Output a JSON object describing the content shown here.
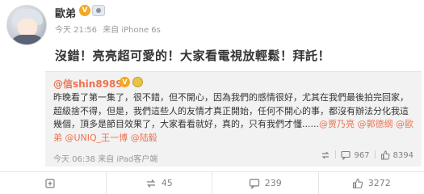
{
  "post": {
    "username": "歐弟",
    "vip_badge": "V",
    "time": "今天 21:56",
    "source": "来自 iPhone 6s",
    "text": "沒錯！亮亮超可愛的！大家看電視放輕鬆！拜託！"
  },
  "repost": {
    "username": "@信shin8989",
    "vip_badge": "V",
    "text_plain": "昨晚看了第一集了，很不錯，但不開心，因為我們的感情很好，尤其在我們最後拍完回家，超級捨不得，但是，我們這些人的友情才真正開始，任何不開心的事，都沒有辦法分化我這幾個，頂多是節目效果了，大家看看就好，真的，只有我們才懂......",
    "mentions": [
      "@贾乃亮",
      "@郭德纲",
      "@歐弟",
      "@UNIQ_王一博",
      "@陆毅"
    ],
    "time": "今天 06:38",
    "source": "来自 iPad客户端",
    "shares": "967",
    "likes": "8394"
  },
  "actions": {
    "collect": "",
    "repost": "45",
    "comment": "239",
    "like": "3272"
  },
  "colors": {
    "mention": "#eb7350",
    "muted": "#999999"
  }
}
